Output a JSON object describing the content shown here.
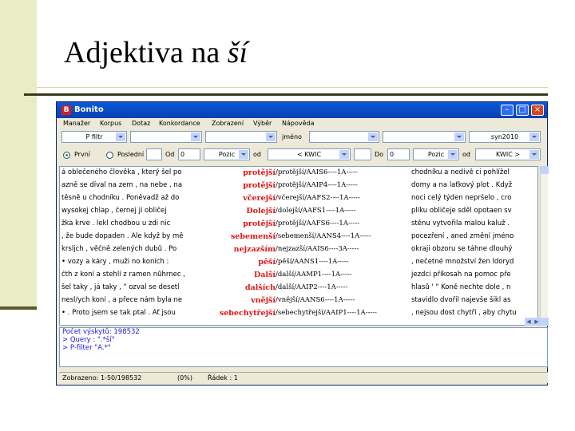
{
  "slide": {
    "title_plain": "Adjektiva na ",
    "title_italic": "ší"
  },
  "window": {
    "title": "Bonito",
    "app_icon": "B",
    "buttons": {
      "minimize": "–",
      "maximize": "□",
      "close": "×"
    }
  },
  "menu": [
    "Manažer",
    "Korpus",
    "Dotaz",
    "Konkordance",
    "Zobrazení",
    "Výběr",
    "Nápověda"
  ],
  "controls": {
    "filter": "P filtr",
    "name_label": "jméno",
    "corpus": "syn2010",
    "radio_first": "První",
    "radio_last": "Poslední",
    "od_label": "Od",
    "od_value": "0",
    "pozic1": "Pozic",
    "od2_label": "od",
    "kwic_left": "< KWIC",
    "do_label": "Do",
    "do_value": "0",
    "pozic2": "Pozic",
    "od3_label": "od",
    "kwic_right": "KWIC >"
  },
  "concordance": [
    {
      "left": "á oblečeného člověka , který šel po",
      "kwic": "protější",
      "tag": "/protější/AAIS6----1A-----",
      "right": "chodníku a nedívě ci pohlížel"
    },
    {
      "left": "azně se díval na zem , na nebe , na",
      "kwic": "protější",
      "tag": "/protější/AAIP4----1A-----",
      "right": "domy a na laťkový plot . Když"
    },
    {
      "left": "těsně u chodníku . Poněvadž až do",
      "kwic": "včerejší",
      "tag": "/včerejší/AAFS2----1A-----",
      "right": "noci celý týden nepršelo , cro"
    },
    {
      "left": "wysokej chlap , černej jí obličej",
      "kwic": "Dolejší",
      "tag": "/dolejší/AAFS1----1A-----",
      "right": "plíku obličeje sděl opotaen sv"
    },
    {
      "left": "žka krve . lekl chodbou u zdi nic",
      "kwic": "protější",
      "tag": "/protější/AAFS6----1A-----",
      "right": "stěnu vytvořila malou kaluž ."
    },
    {
      "left": ", že bude dopaden . Ale když by mě",
      "kwic": "sebemenší",
      "tag": "/sebemenší/AANS4----1A-----",
      "right": "pocezření , aned změní jméno"
    },
    {
      "left": "krsljch , věčně zelených dubů . Po",
      "kwic": "nejzazším",
      "tag": "/nejzazší/AAIS6----3A-----",
      "right": "okraji obzoru se táhne dlouhý"
    },
    {
      "left": "• vozy a káry , muži no koních :",
      "kwic": "pěší",
      "tag": "/pěší/AANS1----1A-----",
      "right": ", nečetné množství žen ldoryd"
    },
    {
      "left": "čth z koní a stehlí z ramen nůhrnec ,",
      "kwic": "Další",
      "tag": "/další/AAMP1----1A-----",
      "right": "jezdci příkosah na pomoc pře"
    },
    {
      "left": "šel taky , já taky , \" ozval se desetl",
      "kwic": "dalších",
      "tag": "/další/AAIP2----1A-----",
      "right": "hlasů ' \" Koně nechte dole , n"
    },
    {
      "left": "nesl/ych koní , a přece nám byla ne",
      "kwic": "vnější",
      "tag": "/vnější/AANS6----1A-----",
      "right": "stavidlo dvořil najevše šikl as"
    },
    {
      "left": "• . Proto jsem se tak ptal . Ať jsou",
      "kwic": "sebechytřejší",
      "tag": "/sebechytřejší/AAIP1----1A-----",
      "right": ", nejsou dost chytří , aby chytu"
    }
  ],
  "info": {
    "count": "Počet výskytů: 198532",
    "query": "  > Query : \".*ší\"",
    "filter": "  > P-filter \"A.*\""
  },
  "status": {
    "shown": "Zobrazeno: 1-50/198532",
    "percent": "(0%)",
    "row": "Řádek : 1"
  }
}
